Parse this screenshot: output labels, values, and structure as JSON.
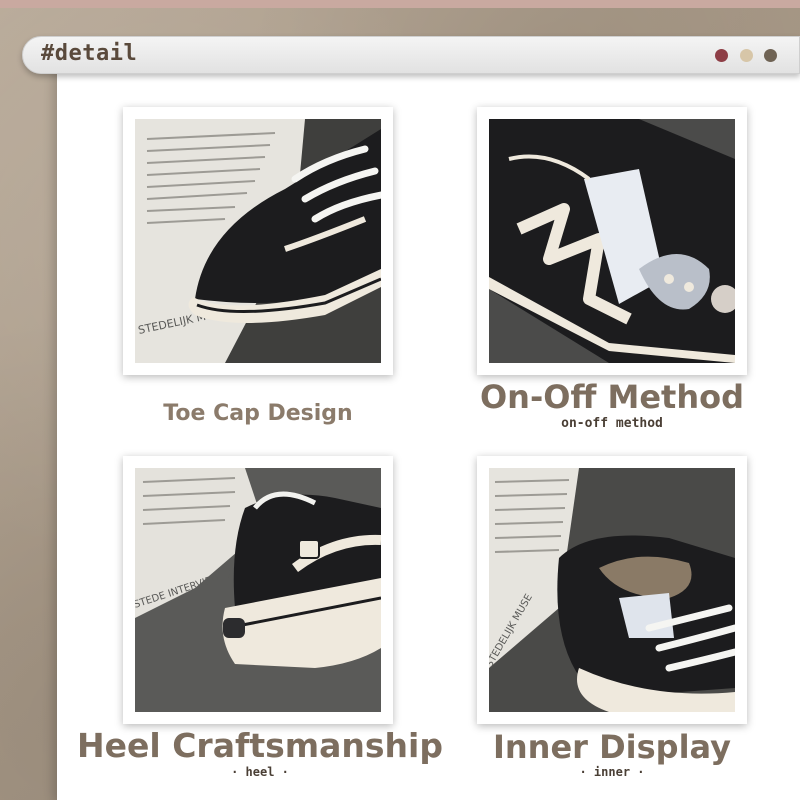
{
  "window": {
    "title": "#detail",
    "dots": [
      "#8e3e46",
      "#d7c6a8",
      "#6f6354"
    ]
  },
  "panels": [
    {
      "title": "Toe Cap Design",
      "subtitle": "",
      "photo": "shoe-toe-cap-photo"
    },
    {
      "title": "On-Off Method",
      "subtitle": "on-off method",
      "photo": "shoe-strap-photo"
    },
    {
      "title": "Heel Craftsmanship",
      "subtitle": "· heel ·",
      "photo": "shoe-heel-photo"
    },
    {
      "title": "Inner Display",
      "subtitle": "· inner ·",
      "photo": "shoe-inner-photo"
    }
  ],
  "colors": {
    "caption": "#7d6e5f",
    "subtitle": "#4a3f35",
    "shoe_black": "#1c1c1e",
    "sole_cream": "#efe9dd"
  }
}
